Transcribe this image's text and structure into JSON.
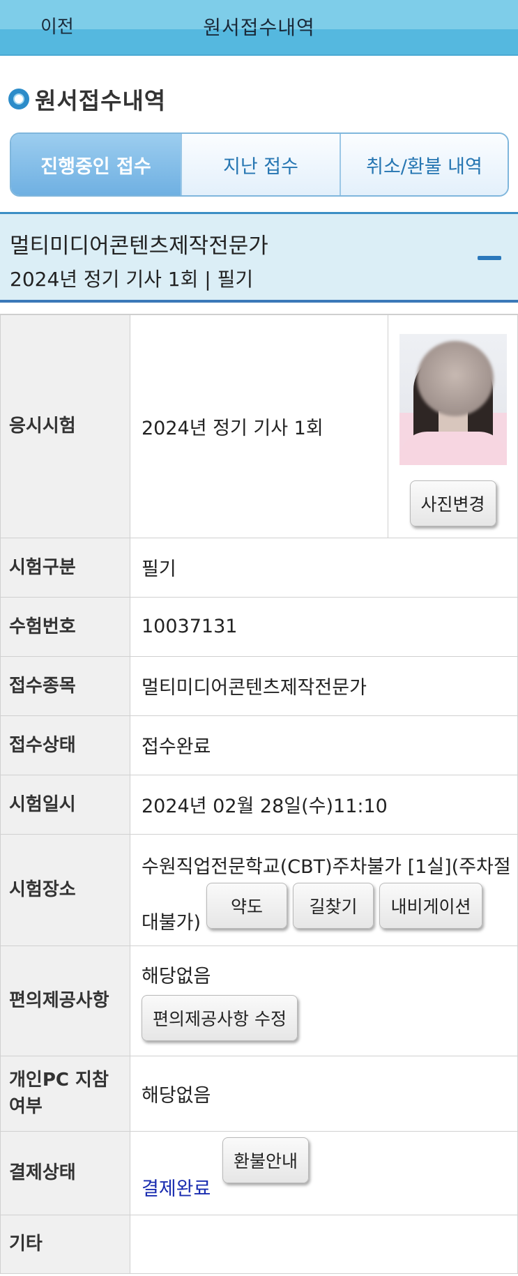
{
  "header": {
    "back_label": "이전",
    "title": "원서접수내역"
  },
  "section": {
    "title": "원서접수내역",
    "icon": "bullet-circle-icon"
  },
  "tabs": [
    {
      "label": "진행중인 접수",
      "active": true
    },
    {
      "label": "지난 접수",
      "active": false
    },
    {
      "label": "취소/환불 내역",
      "active": false
    }
  ],
  "exam": {
    "name": "멀티미디어콘텐츠제작전문가",
    "subtitle": "2024년 정기 기사 1회 | 필기"
  },
  "details": {
    "exam_label": "응시시험",
    "exam_value": "2024년 정기 기사 1회",
    "photo_change_label": "사진변경",
    "type_label": "시험구분",
    "type_value": "필기",
    "number_label": "수험번호",
    "number_value": "10037131",
    "item_label": "접수종목",
    "item_value": "멀티미디어콘텐츠제작전문가",
    "status_label": "접수상태",
    "status_value": "접수완료",
    "datetime_label": "시험일시",
    "datetime_value": "2024년 02월 28일(수)11:10",
    "place_label": "시험장소",
    "place_line1": "수원직업전문학교(CBT)주차불가 [1실](주차절",
    "place_line2": "대불가)",
    "map_label": "약도",
    "route_label": "길찾기",
    "nav_label": "내비게이션",
    "convenience_label": "편의제공사항",
    "convenience_value": "해당없음",
    "convenience_edit_label": "편의제공사항 수정",
    "pc_label": "개인PC 지참 여부",
    "pc_value": "해당없음",
    "payment_label": "결제상태",
    "payment_value": "결제완료",
    "refund_label": "환불안내",
    "etc_label": "기타",
    "etc_value": ""
  },
  "colors": {
    "accent": "#2c8cc9",
    "status_blue": "#1a2db0",
    "header_bg": "#7ecde9"
  }
}
